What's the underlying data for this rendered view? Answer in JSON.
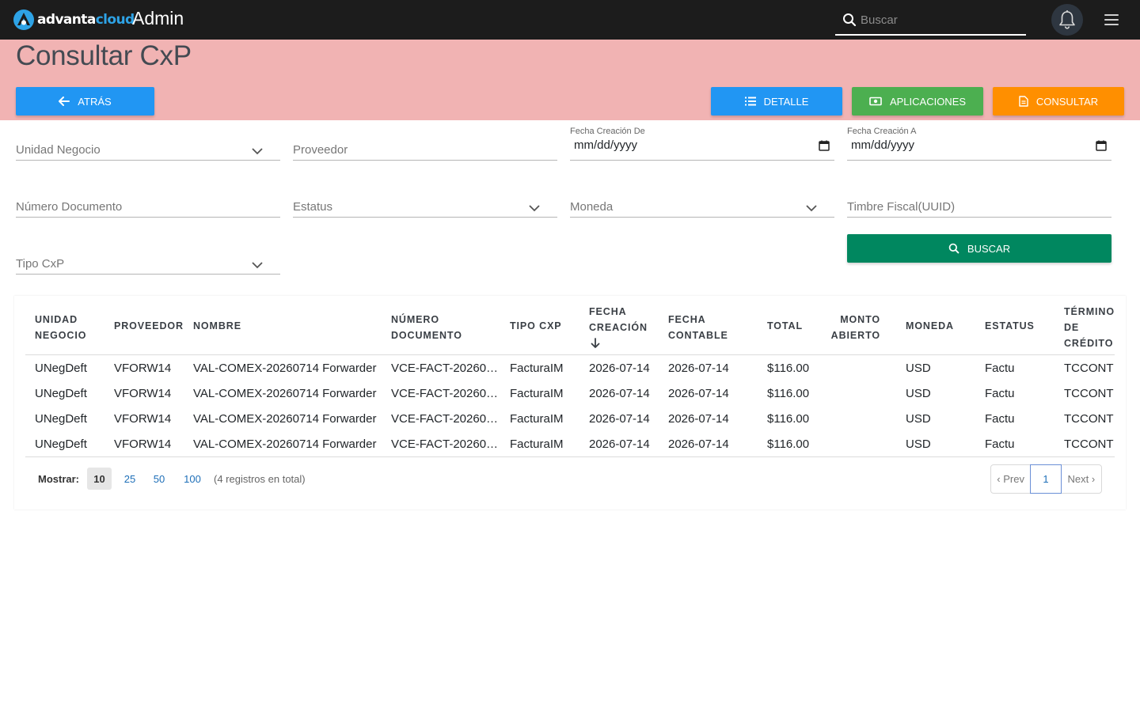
{
  "topbar": {
    "logo_text_a": "advanta",
    "logo_text_b": "cloud",
    "app_title": "Admin",
    "search_placeholder": "Buscar"
  },
  "header": {
    "page_title": "Consultar CxP",
    "back_label": "ATRÁS",
    "detail_label": "DETALLE",
    "apps_label": "APLICACIONES",
    "consult_label": "CONSULTAR"
  },
  "filters": {
    "unidad_negocio": "Unidad Negocio",
    "proveedor": "Proveedor",
    "fecha_de_label": "Fecha Creación De",
    "fecha_de_value": "mm/dd/yyyy",
    "fecha_a_label": "Fecha Creación A",
    "fecha_a_value": "mm/dd/yyyy",
    "numero_documento": "Número Documento",
    "estatus": "Estatus",
    "moneda": "Moneda",
    "timbre_fiscal": "Timbre Fiscal(UUID)",
    "tipo_cxp": "Tipo CxP",
    "search_label": "BUSCAR"
  },
  "table": {
    "headers": {
      "unidad": "UNIDAD NEGOCIO",
      "proveedor": "PROVEEDOR",
      "nombre": "NOMBRE",
      "numero": "NÚMERO DOCUMENTO",
      "tipo": "TIPO CXP",
      "fecha_creacion": "FECHA CREACIÓN",
      "fecha_contable": "FECHA CONTABLE",
      "total": "TOTAL",
      "monto": "MONTO ABIERTO",
      "moneda": "MONEDA",
      "estatus": "ESTATUS",
      "termino": "TÉRMINO DE CRÉDITO"
    },
    "rows": [
      {
        "unidad": "UNegDeft",
        "proveedor": "VFORW14",
        "nombre": "VAL-COMEX-20260714 Forwarder",
        "numero": "VCE-FACT-20260…",
        "tipo": "FacturaIM",
        "fecha_creacion": "2026-07-14",
        "fecha_contable": "2026-07-14",
        "total": "$116.00",
        "monto": "",
        "moneda": "USD",
        "estatus": "Factu",
        "termino": "TCCONT"
      },
      {
        "unidad": "UNegDeft",
        "proveedor": "VFORW14",
        "nombre": "VAL-COMEX-20260714 Forwarder",
        "numero": "VCE-FACT-20260…",
        "tipo": "FacturaIM",
        "fecha_creacion": "2026-07-14",
        "fecha_contable": "2026-07-14",
        "total": "$116.00",
        "monto": "",
        "moneda": "USD",
        "estatus": "Factu",
        "termino": "TCCONT"
      },
      {
        "unidad": "UNegDeft",
        "proveedor": "VFORW14",
        "nombre": "VAL-COMEX-20260714 Forwarder",
        "numero": "VCE-FACT-20260…",
        "tipo": "FacturaIM",
        "fecha_creacion": "2026-07-14",
        "fecha_contable": "2026-07-14",
        "total": "$116.00",
        "monto": "",
        "moneda": "USD",
        "estatus": "Factu",
        "termino": "TCCONT"
      },
      {
        "unidad": "UNegDeft",
        "proveedor": "VFORW14",
        "nombre": "VAL-COMEX-20260714 Forwarder",
        "numero": "VCE-FACT-20260…",
        "tipo": "FacturaIM",
        "fecha_creacion": "2026-07-14",
        "fecha_contable": "2026-07-14",
        "total": "$116.00",
        "monto": "",
        "moneda": "USD",
        "estatus": "Factu",
        "termino": "TCCONT"
      }
    ]
  },
  "footer": {
    "mostrar_label": "Mostrar:",
    "page_sizes": [
      "10",
      "25",
      "50",
      "100"
    ],
    "total_note": "(4 registros en total)",
    "prev_label": "‹ Prev",
    "current_page": "1",
    "next_label": "Next ›"
  },
  "colors": {
    "topbar_bg": "#1c1c1c",
    "header_band_bg": "#f1b3b3",
    "primary_blue": "#2196f3",
    "green": "#4caf50",
    "orange": "#ff8f00",
    "search_green": "#00875f"
  }
}
